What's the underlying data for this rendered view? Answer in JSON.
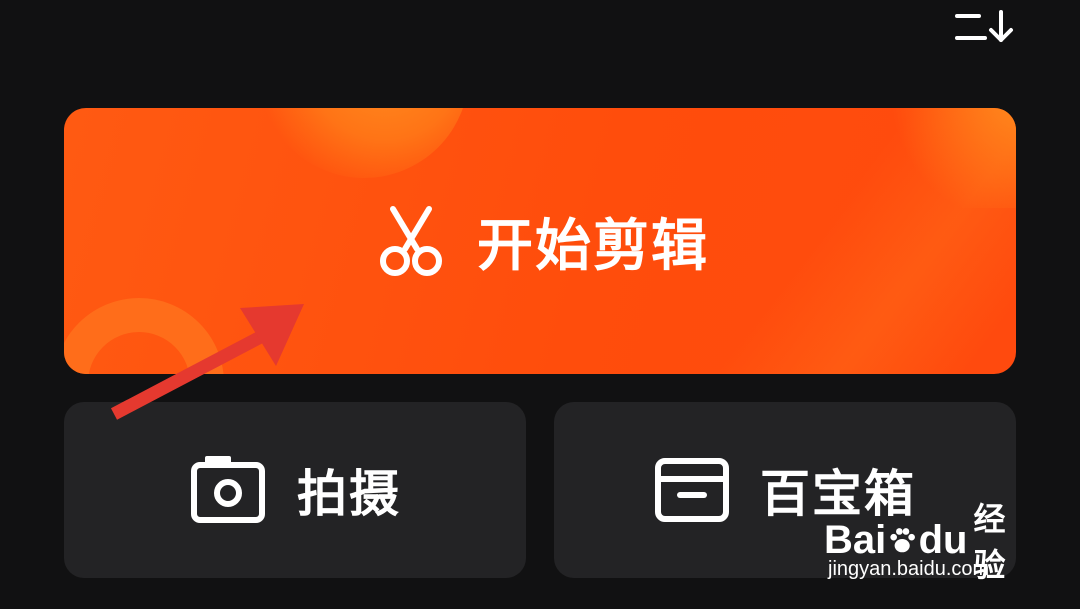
{
  "toolbar": {
    "sort_icon": "sort-down-icon"
  },
  "main_action": {
    "label": "开始剪辑",
    "icon": "scissors-icon",
    "colors": {
      "background": "#ff5210",
      "accent": "#ff8d1f",
      "text": "#ffffff"
    }
  },
  "quick_actions": [
    {
      "label": "拍摄",
      "icon": "camera-icon"
    },
    {
      "label": "百宝箱",
      "icon": "toolbox-icon"
    }
  ],
  "annotation": {
    "type": "arrow",
    "color": "#e5392f"
  },
  "watermark": {
    "logo_text": "Bai",
    "logo_suffix": "du",
    "logo_cn": "经验",
    "url": "jingyan.baidu.com"
  },
  "colors": {
    "screen_background": "#111112",
    "card_background": "#232325"
  }
}
